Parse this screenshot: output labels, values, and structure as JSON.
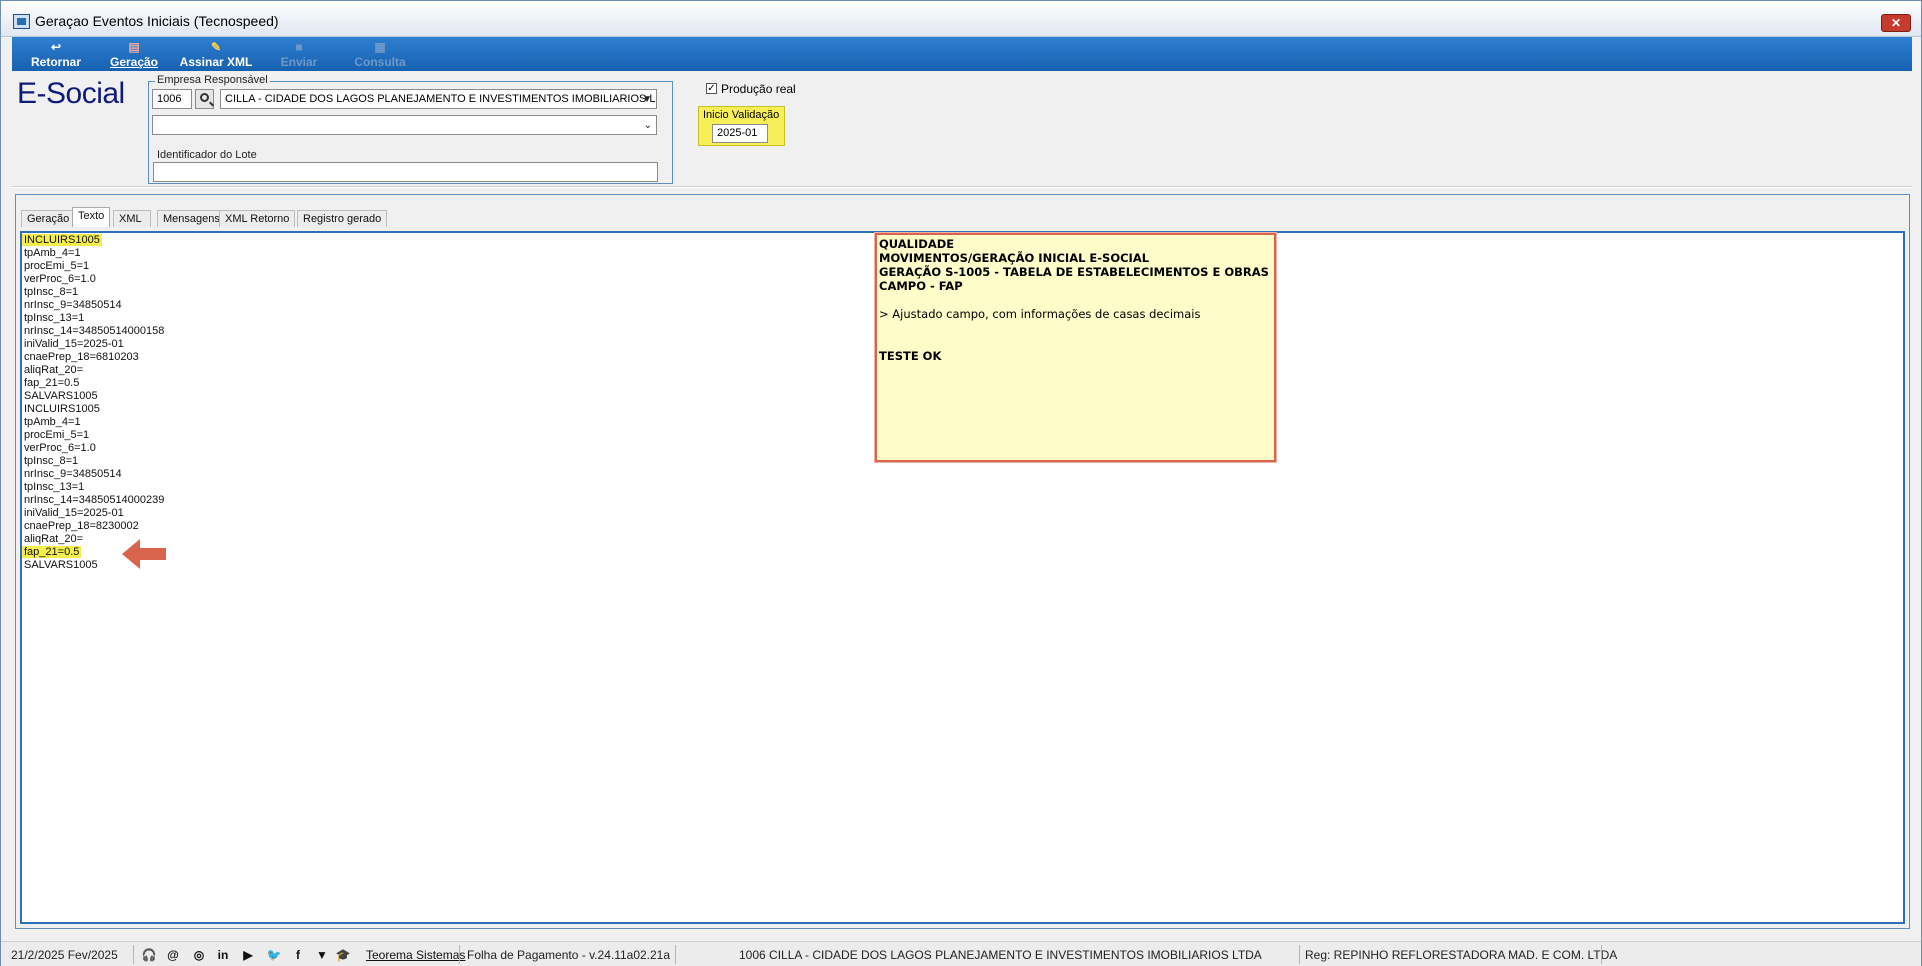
{
  "window": {
    "title": "Geraçao Eventos Iniciais (Tecnospeed)",
    "close_glyph": "✕"
  },
  "toolbar": {
    "buttons": [
      {
        "label": "Retornar",
        "icon": "return-icon",
        "enabled": true
      },
      {
        "label": "Geração",
        "icon": "generate-icon",
        "enabled": true
      },
      {
        "label": "Assinar XML",
        "icon": "sign-xml-icon",
        "enabled": true
      },
      {
        "label": "Enviar",
        "icon": "send-icon",
        "enabled": false
      },
      {
        "label": "Consulta",
        "icon": "query-icon",
        "enabled": false
      }
    ]
  },
  "header": {
    "logo": "E-Social",
    "empresa_group_title": "Empresa Responsável",
    "empresa_code": "1006",
    "empresa_name": "CILLA - CIDADE DOS LAGOS PLANEJAMENTO E INVESTIMENTOS IMOBILIARIOS L",
    "empresa_second_value": "",
    "lote_label": "Identificador do Lote",
    "lote_value": "",
    "producao_label": "Produção real",
    "producao_checked": true,
    "inicio_label": "Inicio Validação",
    "inicio_value": "2025-01"
  },
  "tabs": [
    {
      "label": "Geração",
      "active": false
    },
    {
      "label": "Texto",
      "active": true
    },
    {
      "label": "XML",
      "active": false
    },
    {
      "label": "Mensagens",
      "active": false
    },
    {
      "label": "XML Retorno",
      "active": false
    },
    {
      "label": "Registro gerado",
      "active": false
    }
  ],
  "text_content": [
    "INCLUIRS1005",
    "tpAmb_4=1",
    "procEmi_5=1",
    "verProc_6=1.0",
    "tpInsc_8=1",
    "nrInsc_9=34850514",
    "tpInsc_13=1",
    "nrInsc_14=34850514000158",
    "iniValid_15=2025-01",
    "cnaePrep_18=6810203",
    "aliqRat_20=",
    "fap_21=0.5",
    "SALVARS1005",
    "INCLUIRS1005",
    "tpAmb_4=1",
    "procEmi_5=1",
    "verProc_6=1.0",
    "tpInsc_8=1",
    "nrInsc_9=34850514",
    "tpInsc_13=1",
    "nrInsc_14=34850514000239",
    "iniValid_15=2025-01",
    "cnaePrep_18=8230002",
    "aliqRat_20=",
    "fap_21=0.5",
    "SALVARS1005"
  ],
  "highlight_colors": {
    "yellow": "#f4ed4e",
    "note_bg": "#fefcc8",
    "note_border": "#d9644d",
    "arrow": "#d9644d"
  },
  "note": {
    "lines": [
      "QUALIDADE",
      "MOVIMENTOS/GERAÇÃO INICIAL E-SOCIAL",
      "GERAÇÃO S-1005 - TABELA DE ESTABELECIMENTOS E OBRAS",
      "CAMPO - FAP",
      "",
      "> Ajustado campo, com informações de casas decimais",
      "",
      "",
      "TESTE OK"
    ]
  },
  "statusbar": {
    "date": "21/2/2025 Fev/2025",
    "company_link": "Teorema Sistemas",
    "product": "Folha de Pagamento - v.24.11a02.21a",
    "empresa": "1006 CILLA - CIDADE DOS LAGOS PLANEJAMENTO E INVESTIMENTOS IMOBILIARIOS LTDA",
    "reg": "Reg: REPINHO REFLORESTADORA MAD. E COM. LTDA",
    "social_icons": [
      "headset-icon",
      "at-icon",
      "instagram-icon",
      "linkedin-icon",
      "youtube-icon",
      "twitter-icon",
      "facebook-icon",
      "brand-icon",
      "graduation-icon"
    ],
    "social_glyphs": [
      "🎧",
      "@",
      "◎",
      "in",
      "▶",
      "🐦",
      "f",
      "▼",
      "🎓"
    ]
  }
}
